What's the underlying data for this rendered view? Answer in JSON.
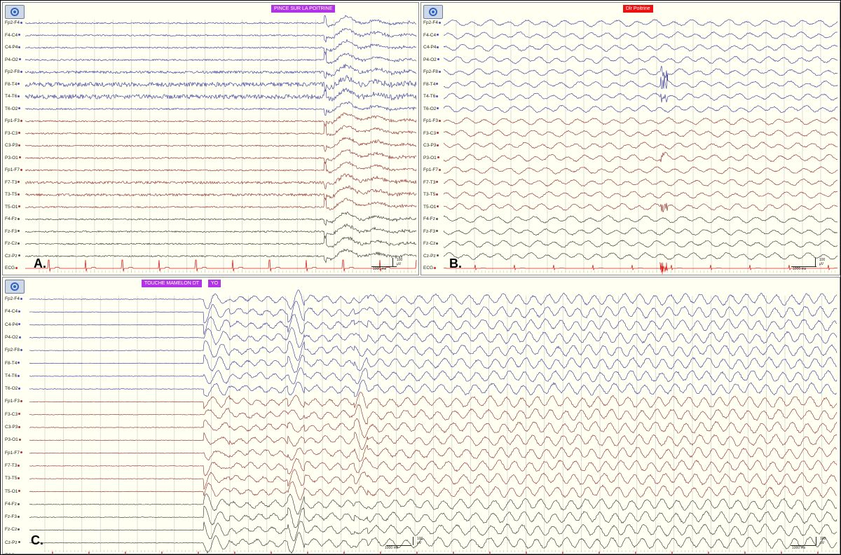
{
  "channels": [
    "Fp2-F4",
    "F4-C4",
    "C4-P4",
    "P4-O2",
    "Fp2-F8",
    "F8-T4",
    "T4-T6",
    "T6-O2",
    "Fp1-F3",
    "F3-C3",
    "C3-P3",
    "P3-O1",
    "Fp1-F7",
    "F7-T3",
    "T3-T5",
    "T5-O1",
    "F4-Fz",
    "Fz-F3",
    "Fz-Cz",
    "Cz-Pz",
    "ECG"
  ],
  "colors": {
    "right": "#2f2f9a",
    "left": "#8a2323",
    "mid": "#2b2b2b",
    "ecg": "#dd2222"
  },
  "panels": [
    {
      "id": "A",
      "label": "A.",
      "annotations": [
        {
          "text": "PINCE  SUR LA POITRINE",
          "color": "purple"
        }
      ],
      "scale": {
        "amp": "100 µV",
        "time": "1000 ms"
      }
    },
    {
      "id": "B",
      "label": "B.",
      "annotations": [
        {
          "text": "Dlr Poitrine",
          "color": "red"
        }
      ],
      "scale": {
        "amp": "100 µV",
        "time": "1000 ms"
      }
    },
    {
      "id": "C",
      "label": "C.",
      "annotations": [
        {
          "text": "TOUCHE MAMELON DT",
          "color": "purple"
        },
        {
          "text": "YO",
          "color": "purple"
        }
      ],
      "scale": {
        "amp": "100 µV",
        "time": "1000 ms"
      }
    }
  ]
}
